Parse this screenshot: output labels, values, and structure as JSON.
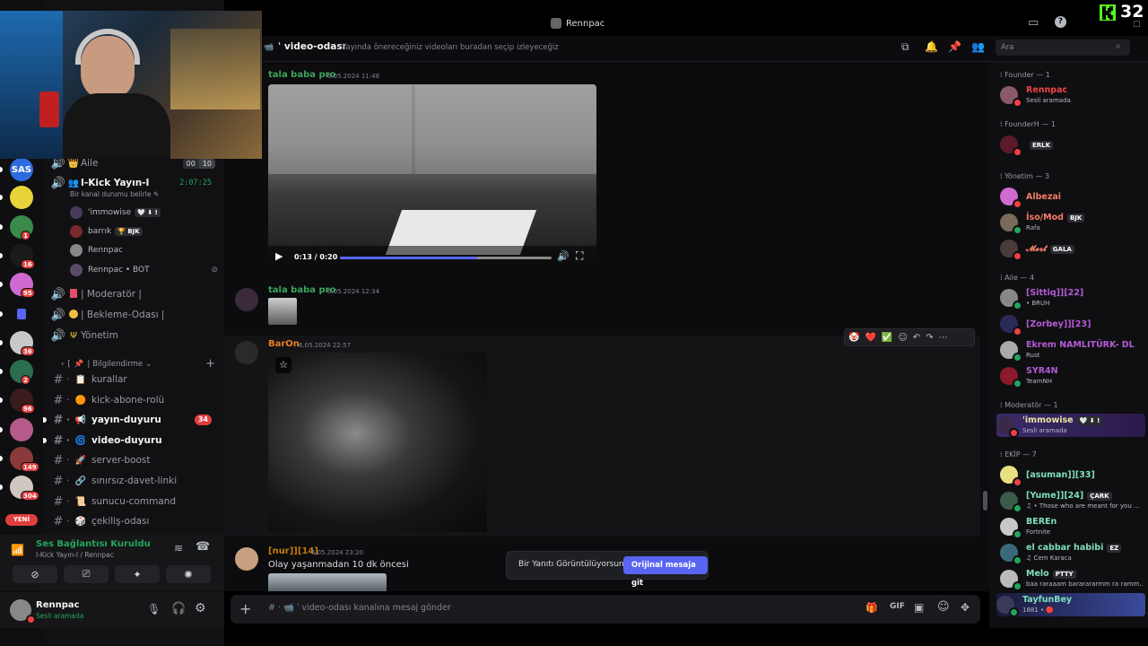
{
  "window": {
    "title": "Rennpac",
    "counter": "32"
  },
  "channel_header": {
    "name": "video-odası",
    "topic": "Yayında önereceğiniz videoları buradan seçip izleyeceğiz",
    "search_placeholder": "Ara"
  },
  "servers": [
    {
      "label": "SAS",
      "color": "#2d6cdf",
      "badge": ""
    },
    {
      "label": "",
      "color": "#e8d43a",
      "badge": ""
    },
    {
      "label": "",
      "color": "#3a8a4a",
      "badge": "1"
    },
    {
      "label": "",
      "color": "#1b1b1b",
      "badge": "16"
    },
    {
      "label": "",
      "color": "#d06ad0",
      "badge": "95"
    },
    {
      "label": "",
      "color": "#5865f2",
      "badge": ""
    },
    {
      "label": "",
      "color": "#c8c8c8",
      "badge": "36"
    },
    {
      "label": "",
      "color": "#2b6e4e",
      "badge": "2"
    },
    {
      "label": "",
      "color": "#3b1b1b",
      "badge": "96"
    },
    {
      "label": "",
      "color": "#b55a8a",
      "badge": ""
    },
    {
      "label": "",
      "color": "#8a3a3a",
      "badge": "149"
    },
    {
      "label": "",
      "color": "#d0c8c0",
      "badge": "304"
    }
  ],
  "servers_new_label": "YENİ",
  "sidebar": {
    "aile": {
      "label": "Aile",
      "count_left": "00",
      "count_right": "10"
    },
    "voice_channel": {
      "name": "I-Kick Yayın-I",
      "time": "2:07:25",
      "status": "Bir kanal durumu belirle"
    },
    "voice_users": [
      {
        "name": "'immowise",
        "tag": "🤍 ⬇ !"
      },
      {
        "name": "barrık",
        "tag": "🏆 BJK"
      },
      {
        "name": "Rennpac",
        "tag": ""
      },
      {
        "name": "Rennpac • BOT",
        "tag": ""
      }
    ],
    "voice_channels": [
      "| Moderatör |",
      "| Bekleme-Odası |",
      "Yönetim"
    ],
    "category": "Bilgilendirme",
    "text_channels": [
      {
        "name": "kurallar",
        "emoji": "📋",
        "bold": false,
        "badge": ""
      },
      {
        "name": "kick-abone-rolü",
        "emoji": "🟠",
        "bold": false,
        "badge": ""
      },
      {
        "name": "yayın-duyuru",
        "emoji": "📢",
        "bold": true,
        "badge": "34"
      },
      {
        "name": "video-duyuru",
        "emoji": "🌀",
        "bold": true,
        "badge": ""
      },
      {
        "name": "server-boost",
        "emoji": "🚀",
        "bold": false,
        "badge": ""
      },
      {
        "name": "sınırsız-davet-linki",
        "emoji": "🔗",
        "bold": false,
        "badge": ""
      },
      {
        "name": "sunucu-command",
        "emoji": "📜",
        "bold": false,
        "badge": ""
      },
      {
        "name": "çekiliş-odası",
        "emoji": "🎲",
        "bold": false,
        "badge": ""
      }
    ]
  },
  "voice_panel": {
    "status": "Ses Bağlantısı Kuruldu",
    "location": "I-Kick Yayın-I / Rennpac"
  },
  "user_panel": {
    "name": "Rennpac",
    "status": "Sesli aramada"
  },
  "messages": [
    {
      "author": "tala baba pro",
      "time": "6.05.2024 11:48",
      "color": "#3ba55c",
      "video_time": "0:13 / 0:20",
      "progress": 0.65
    },
    {
      "author": "tala baba pro",
      "time": "6.05.2024 12:34",
      "color": "#3ba55c"
    },
    {
      "author": "BarOn",
      "time": "6.05.2024 22:57",
      "color": "#e67e22"
    },
    {
      "author": "[nur]][14]",
      "time": "6.05.2024 23:20",
      "color": "#c27c0e",
      "text": "Olay yaşanmadan 10 dk öncesi"
    }
  ],
  "reply_banner": {
    "text": "Bir Yanıtı Görüntülüyorsun.",
    "button": "Orijinal mesaja git"
  },
  "composer": {
    "placeholder": "video-odası kanalına mesaj gönder"
  },
  "members": {
    "groups": [
      {
        "title": "Founder — 1",
        "items": [
          {
            "name": "Rennpac",
            "sub": "Sesli aramada",
            "color": "#ed4245",
            "tag": ""
          }
        ]
      },
      {
        "title": "FounderH — 1",
        "items": [
          {
            "name": "",
            "sub": "",
            "color": "#ed4245",
            "tag": "ERLK"
          }
        ]
      },
      {
        "title": "Yönetim — 3",
        "items": [
          {
            "name": "Albezai",
            "sub": "",
            "color": "#f47b67",
            "tag": ""
          },
          {
            "name": "İso/Mod",
            "sub": "Rafa",
            "color": "#f47b67",
            "tag": "BJK"
          },
          {
            "name": "𝓜𝓮𝓻𝓽",
            "sub": "",
            "color": "#f47b67",
            "tag": "GALA"
          }
        ]
      },
      {
        "title": "Aile — 4",
        "items": [
          {
            "name": "[Sittiq]][22]",
            "sub": "• BRUH",
            "color": "#b45bd6",
            "tag": ""
          },
          {
            "name": "[Zorbey]][23]",
            "sub": "",
            "color": "#b45bd6",
            "tag": ""
          },
          {
            "name": "Ekrem NAMLITÜRK- DL",
            "sub": "Rust",
            "color": "#b45bd6",
            "tag": ""
          },
          {
            "name": "SYR4N",
            "sub": "TeamNH",
            "color": "#b45bd6",
            "tag": ""
          }
        ]
      },
      {
        "title": "Moderatör — 1",
        "items": [
          {
            "name": "'immowise",
            "sub": "Sesli aramada",
            "color": "#e8e8a0",
            "tag": "🤍 ⬇ !"
          }
        ]
      },
      {
        "title": "EKİP — 7",
        "items": [
          {
            "name": "[asuman]][33]",
            "sub": "",
            "color": "#7ee0c0",
            "tag": ""
          },
          {
            "name": "[Yume]][24]",
            "sub": "♫ • Those who are meant for you ...",
            "color": "#7ee0c0",
            "tag": "ÇARK"
          },
          {
            "name": "BEREn",
            "sub": "Fortnite",
            "color": "#7ee0c0",
            "tag": ""
          },
          {
            "name": "el cabbar habibi",
            "sub": "♫ Cem Karaca",
            "color": "#7ee0c0",
            "tag": "EZ"
          },
          {
            "name": "Melo",
            "sub": "baa raraaam bararararmm ra ramm...",
            "color": "#7ee0c0",
            "tag": "PTTY"
          },
          {
            "name": "TayfunBey",
            "sub": "1881 • 🔴",
            "color": "#7ee0c0",
            "tag": ""
          }
        ]
      }
    ]
  },
  "colors": {
    "accent": "#5865f2",
    "online": "#23a55a",
    "dnd": "#f23f43"
  }
}
